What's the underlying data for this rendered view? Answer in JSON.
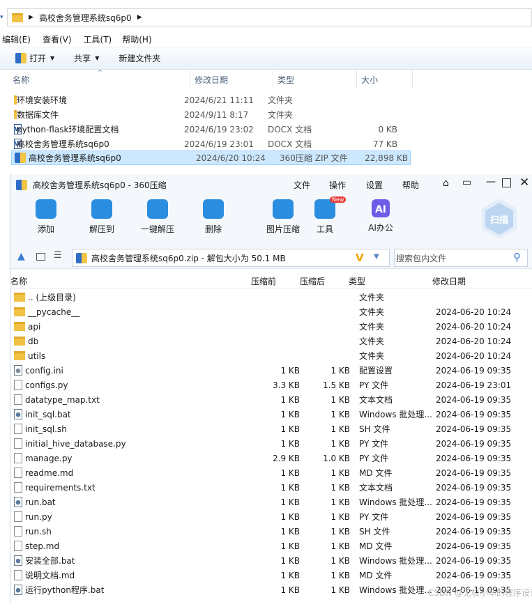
{
  "explorer": {
    "breadcrumb": [
      "高校舍务管理系统sq6p0"
    ],
    "menu": [
      "编辑(E)",
      "查看(V)",
      "工具(T)",
      "帮助(H)"
    ],
    "toolbar": {
      "open": "打开",
      "share": "共享",
      "new_folder": "新建文件夹"
    },
    "columns": {
      "name": "名称",
      "modified": "修改日期",
      "type": "类型",
      "size": "大小"
    },
    "files": [
      {
        "name": "环境安装环境",
        "modified": "2024/6/21 11:11",
        "type": "文件夹",
        "size": "",
        "icon": "folder-icon"
      },
      {
        "name": "数据库文件",
        "modified": "2024/9/11 8:17",
        "type": "文件夹",
        "size": "",
        "icon": "folder-icon"
      },
      {
        "name": "python-flask环境配置文档",
        "modified": "2024/6/19 23:02",
        "type": "DOCX 文档",
        "size": "0 KB",
        "icon": "docx-icon"
      },
      {
        "name": "高校舍务管理系统sq6p0",
        "modified": "2024/6/19 23:01",
        "type": "DOCX 文档",
        "size": "77 KB",
        "icon": "docx-icon"
      },
      {
        "name": "高校舍务管理系统sq6p0",
        "modified": "2024/6/20 10:24",
        "type": "360压缩 ZIP 文件",
        "size": "22,898 KB",
        "icon": "zip-icon",
        "selected": true
      }
    ]
  },
  "archiver": {
    "title": "高校舍务管理系统sq6p0 - 360压缩",
    "menu": [
      "文件",
      "操作",
      "设置",
      "帮助"
    ],
    "tools": [
      {
        "label": "添加",
        "icon": "add-icon",
        "color": "#2a8de0"
      },
      {
        "label": "解压到",
        "icon": "extract-to-icon",
        "color": "#2a8de0"
      },
      {
        "label": "一键解压",
        "icon": "one-click-extract-icon",
        "color": "#2a8de0"
      },
      {
        "label": "删除",
        "icon": "delete-icon",
        "color": "#2a8de0"
      },
      {
        "label": "图片压缩",
        "icon": "image-compress-icon",
        "color": "#2a8de0"
      },
      {
        "label": "工具",
        "icon": "tools-icon",
        "color": "#2a8de0",
        "badge": "New"
      },
      {
        "label": "AI办公",
        "icon": "ai-office-icon",
        "color": "#6c5ce7"
      }
    ],
    "scan_label": "扫描",
    "path_text": "高校舍务管理系统sq6p0.zip - 解包大小为 50.1 MB",
    "search_placeholder": "搜索包内文件",
    "columns": {
      "name": "名称",
      "size": "压缩前",
      "compressed": "压缩后",
      "type": "类型",
      "modified": "修改日期"
    },
    "rows": [
      {
        "name": ".. (上级目录)",
        "size": "",
        "compressed": "",
        "type": "文件夹",
        "modified": "",
        "icon": "folder"
      },
      {
        "name": "__pycache__",
        "size": "",
        "compressed": "",
        "type": "文件夹",
        "modified": "2024-06-20 10:24",
        "icon": "folder"
      },
      {
        "name": "api",
        "size": "",
        "compressed": "",
        "type": "文件夹",
        "modified": "2024-06-20 10:24",
        "icon": "folder"
      },
      {
        "name": "db",
        "size": "",
        "compressed": "",
        "type": "文件夹",
        "modified": "2024-06-20 10:24",
        "icon": "folder"
      },
      {
        "name": "utils",
        "size": "",
        "compressed": "",
        "type": "文件夹",
        "modified": "2024-06-20 10:24",
        "icon": "folder"
      },
      {
        "name": "config.ini",
        "size": "1 KB",
        "compressed": "1 KB",
        "type": "配置设置",
        "modified": "2024-06-19 09:35",
        "icon": "ini"
      },
      {
        "name": "configs.py",
        "size": "3.3 KB",
        "compressed": "1.5 KB",
        "type": "PY 文件",
        "modified": "2024-06-19 23:01",
        "icon": "file"
      },
      {
        "name": "datatype_map.txt",
        "size": "1 KB",
        "compressed": "1 KB",
        "type": "文本文档",
        "modified": "2024-06-19 09:35",
        "icon": "file"
      },
      {
        "name": "init_sql.bat",
        "size": "1 KB",
        "compressed": "1 KB",
        "type": "Windows 批处理...",
        "modified": "2024-06-19 09:35",
        "icon": "bat"
      },
      {
        "name": "init_sql.sh",
        "size": "1 KB",
        "compressed": "1 KB",
        "type": "SH 文件",
        "modified": "2024-06-19 09:35",
        "icon": "file"
      },
      {
        "name": "initial_hive_database.py",
        "size": "1 KB",
        "compressed": "1 KB",
        "type": "PY 文件",
        "modified": "2024-06-19 09:35",
        "icon": "file"
      },
      {
        "name": "manage.py",
        "size": "2.9 KB",
        "compressed": "1.0 KB",
        "type": "PY 文件",
        "modified": "2024-06-19 09:35",
        "icon": "file"
      },
      {
        "name": "readme.md",
        "size": "1 KB",
        "compressed": "1 KB",
        "type": "MD 文件",
        "modified": "2024-06-19 09:35",
        "icon": "file"
      },
      {
        "name": "requirements.txt",
        "size": "1 KB",
        "compressed": "1 KB",
        "type": "文本文档",
        "modified": "2024-06-19 09:35",
        "icon": "file"
      },
      {
        "name": "run.bat",
        "size": "1 KB",
        "compressed": "1 KB",
        "type": "Windows 批处理...",
        "modified": "2024-06-19 09:35",
        "icon": "bat"
      },
      {
        "name": "run.py",
        "size": "1 KB",
        "compressed": "1 KB",
        "type": "PY 文件",
        "modified": "2024-06-19 09:35",
        "icon": "file"
      },
      {
        "name": "run.sh",
        "size": "1 KB",
        "compressed": "1 KB",
        "type": "SH 文件",
        "modified": "2024-06-19 09:35",
        "icon": "file"
      },
      {
        "name": "step.md",
        "size": "1 KB",
        "compressed": "1 KB",
        "type": "MD 文件",
        "modified": "2024-06-19 09:35",
        "icon": "file"
      },
      {
        "name": "安装全部.bat",
        "size": "1 KB",
        "compressed": "1 KB",
        "type": "Windows 批处理...",
        "modified": "2024-06-19 09:35",
        "icon": "bat"
      },
      {
        "name": "说明文档.md",
        "size": "1 KB",
        "compressed": "1 KB",
        "type": "MD 文件",
        "modified": "2024-06-19 09:35",
        "icon": "file"
      },
      {
        "name": "运行python程序.bat",
        "size": "1 KB",
        "compressed": "1 KB",
        "type": "Windows 批处理...",
        "modified": "2024-06-19 09:35",
        "icon": "bat"
      }
    ]
  },
  "watermark": "CSDN @无极小卒的程序设计"
}
